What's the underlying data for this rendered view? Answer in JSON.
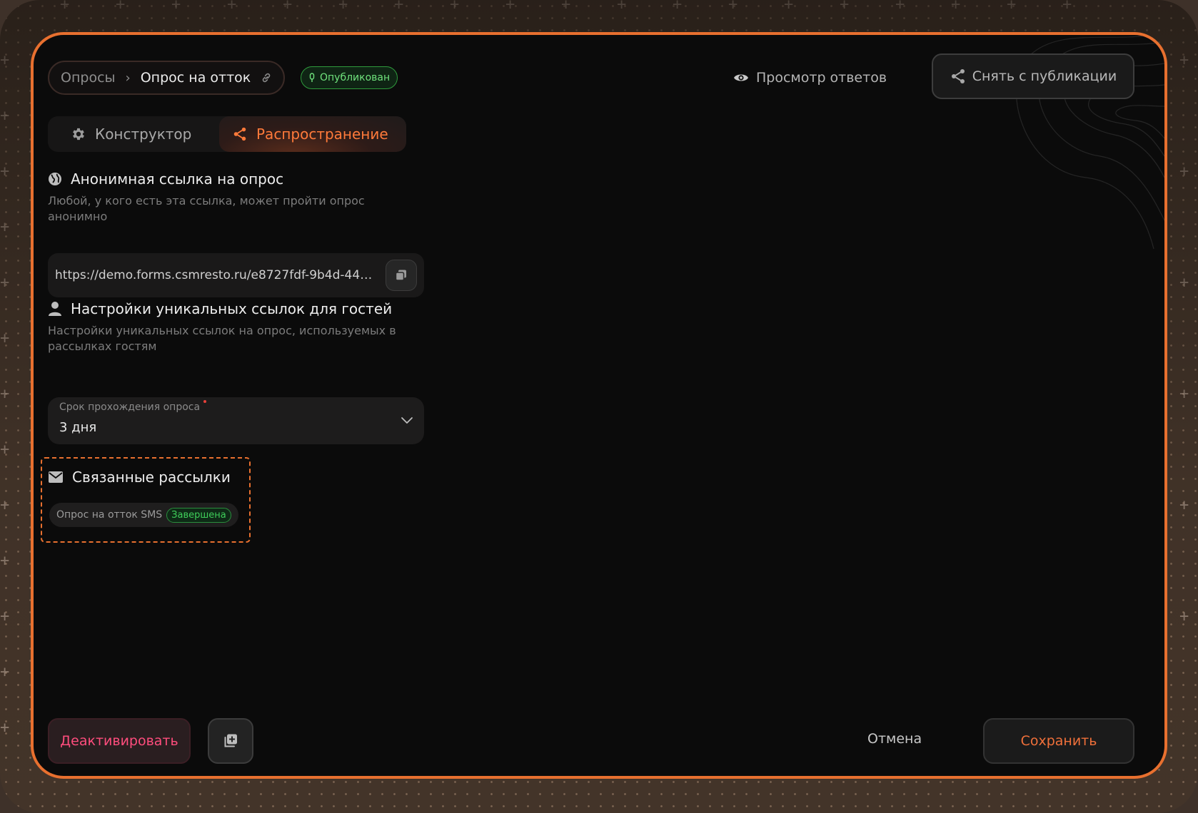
{
  "breadcrumb": {
    "root": "Опросы",
    "current": "Опрос на отток"
  },
  "status_badge": "Опубликован",
  "header": {
    "view_answers": "Просмотр ответов",
    "unpublish": "Снять с публикации"
  },
  "tabs": [
    {
      "label": "Конструктор",
      "icon": "gear-icon",
      "active": false
    },
    {
      "label": "Распространение",
      "icon": "share-icon",
      "active": true
    }
  ],
  "anonymous": {
    "title": "Анонимная ссылка на опрос",
    "description": "Любой, у кого есть эта ссылка, может пройти опрос анонимно",
    "url": "https://demo.forms.csmresto.ru/e8727fdf-9b4d-44d…"
  },
  "unique_links": {
    "title": "Настройки уникальных ссылок для гостей",
    "description": "Настройки уникальных ссылок на опрос, используемых в рассылках гостям",
    "select_label": "Срок прохождения опроса",
    "select_value": "3 дня"
  },
  "linked": {
    "title": "Связанные рассылки",
    "item_name": "Опрос на отток SMS",
    "item_status": "Завершена"
  },
  "footer": {
    "deactivate": "Деактивировать",
    "cancel": "Отмена",
    "save": "Сохранить"
  },
  "colors": {
    "accent": "#e8702f",
    "success": "#3fce5a",
    "danger": "#ff4d7d"
  }
}
